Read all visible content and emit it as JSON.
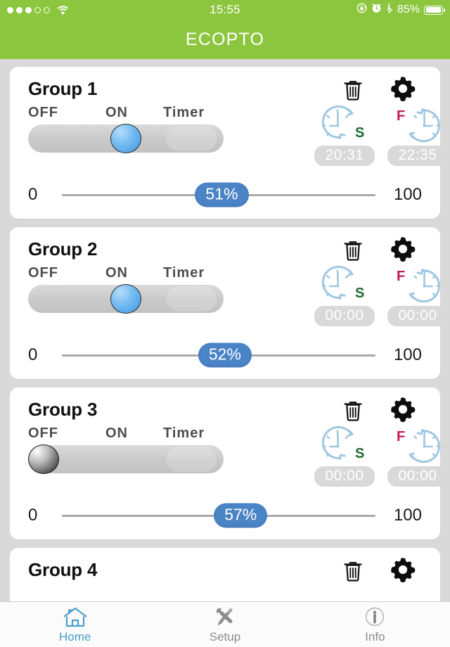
{
  "status_bar": {
    "signal_dots_filled": 3,
    "signal_dots_total": 5,
    "wifi_icon": "wifi-icon",
    "time": "15:55",
    "rotation_lock_icon": "rotation-lock-icon",
    "alarm_icon": "alarm-clock-icon",
    "bluetooth_icon": "bluetooth-icon",
    "battery_percent_label": "85%",
    "battery_level": 85,
    "background_color": "#8cc63f"
  },
  "header": {
    "title": "ECOPTO",
    "background_color": "#8cc63f",
    "text_color": "#ffffff"
  },
  "theme": {
    "page_background": "#d9d9d9",
    "card_background": "#ffffff",
    "accent_blue": "#4a84c6",
    "knob_blue": "#3f96e0",
    "tab_active": "#4a9ec9",
    "tab_inactive": "#8c8c8c",
    "badge_gray": "#d9d9d9",
    "clock_stroke": "#9fc8e0",
    "start_letter_color": "#1c6b2b",
    "finish_letter_color": "#c2185b"
  },
  "toggle": {
    "labels": [
      "OFF",
      "ON",
      "Timer"
    ],
    "positions": {
      "OFF": 0,
      "ON": 117,
      "Timer": 234
    }
  },
  "slider": {
    "min_label": "0",
    "max_label": "100",
    "min": 0,
    "max": 100
  },
  "clock_icons": {
    "start": {
      "icon": "clock-start-icon",
      "letter": "S"
    },
    "finish": {
      "icon": "clock-finish-icon",
      "letter": "F"
    }
  },
  "groups": [
    {
      "name": "Group 1",
      "mode": "ON",
      "knob_state": "on",
      "brightness": 51,
      "brightness_label": "51%",
      "start_time": "20:31",
      "finish_time": "22:35",
      "delete_icon": "trash-icon",
      "settings_icon": "gear-icon",
      "partial": false
    },
    {
      "name": "Group 2",
      "mode": "ON",
      "knob_state": "on",
      "brightness": 52,
      "brightness_label": "52%",
      "start_time": "00:00",
      "finish_time": "00:00",
      "delete_icon": "trash-icon",
      "settings_icon": "gear-icon",
      "partial": false
    },
    {
      "name": "Group 3",
      "mode": "OFF",
      "knob_state": "off",
      "brightness": 57,
      "brightness_label": "57%",
      "start_time": "00:00",
      "finish_time": "00:00",
      "delete_icon": "trash-icon",
      "settings_icon": "gear-icon",
      "partial": false
    },
    {
      "name": "Group 4",
      "mode": "",
      "knob_state": "",
      "brightness": null,
      "brightness_label": "",
      "start_time": "",
      "finish_time": "",
      "delete_icon": "trash-icon",
      "settings_icon": "gear-icon",
      "partial": true
    }
  ],
  "tabs": [
    {
      "label": "Home",
      "icon": "home-icon",
      "active": true
    },
    {
      "label": "Setup",
      "icon": "tools-icon",
      "active": false
    },
    {
      "label": "Info",
      "icon": "info-icon",
      "active": false
    }
  ]
}
